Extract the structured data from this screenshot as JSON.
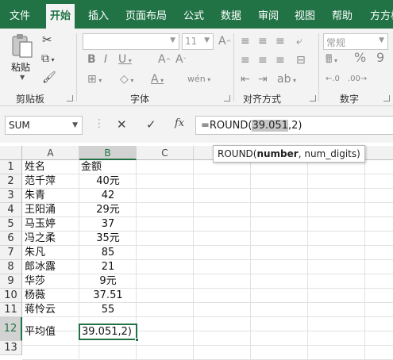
{
  "ribbon_tabs": [
    {
      "label": "文件"
    },
    {
      "label": "开始"
    },
    {
      "label": "插入"
    },
    {
      "label": "页面布局"
    },
    {
      "label": "公式"
    },
    {
      "label": "数据"
    },
    {
      "label": "审阅"
    },
    {
      "label": "视图"
    },
    {
      "label": "帮助"
    },
    {
      "label": "方方格"
    }
  ],
  "active_tab": "开始",
  "clipboard": {
    "paste_label": "粘贴",
    "group_label": "剪贴板"
  },
  "font_group": {
    "font_name": "",
    "font_size": "11",
    "group_label": "字体"
  },
  "alignment_group": {
    "group_label": "对齐方式"
  },
  "number_group": {
    "format": "常规",
    "group_label": "数字"
  },
  "formula_bar": {
    "name_box": "SUM",
    "formula_prefix": "=ROUND(",
    "formula_selected": "39.051",
    "formula_suffix": ",2)"
  },
  "tooltip": {
    "func": "ROUND(",
    "bold_arg": "number",
    "rest": ", num_digits)"
  },
  "columns": [
    "A",
    "B",
    "C"
  ],
  "rows": [
    "1",
    "2",
    "3",
    "4",
    "5",
    "6",
    "7",
    "8",
    "9",
    "10",
    "11",
    "12",
    "13"
  ],
  "table": [
    {
      "a": "姓名",
      "b": "金额"
    },
    {
      "a": "范千萍",
      "b": "40元"
    },
    {
      "a": "朱青",
      "b": "42"
    },
    {
      "a": "王阳涌",
      "b": "29元"
    },
    {
      "a": "马玉婷",
      "b": "37"
    },
    {
      "a": "冯之柔",
      "b": "35元"
    },
    {
      "a": "朱凡",
      "b": "85"
    },
    {
      "a": "郎冰露",
      "b": "21"
    },
    {
      "a": "华莎",
      "b": "9元"
    },
    {
      "a": "杨薇",
      "b": "37.51"
    },
    {
      "a": "蒋怜云",
      "b": "55"
    },
    {
      "a": "平均值",
      "b": ""
    }
  ],
  "active_cell_text": "39.051,2)",
  "colors": {
    "excel_green": "#217346",
    "ribbon_bg": "#f3f3f3",
    "grid_line": "#e1e1e1"
  }
}
